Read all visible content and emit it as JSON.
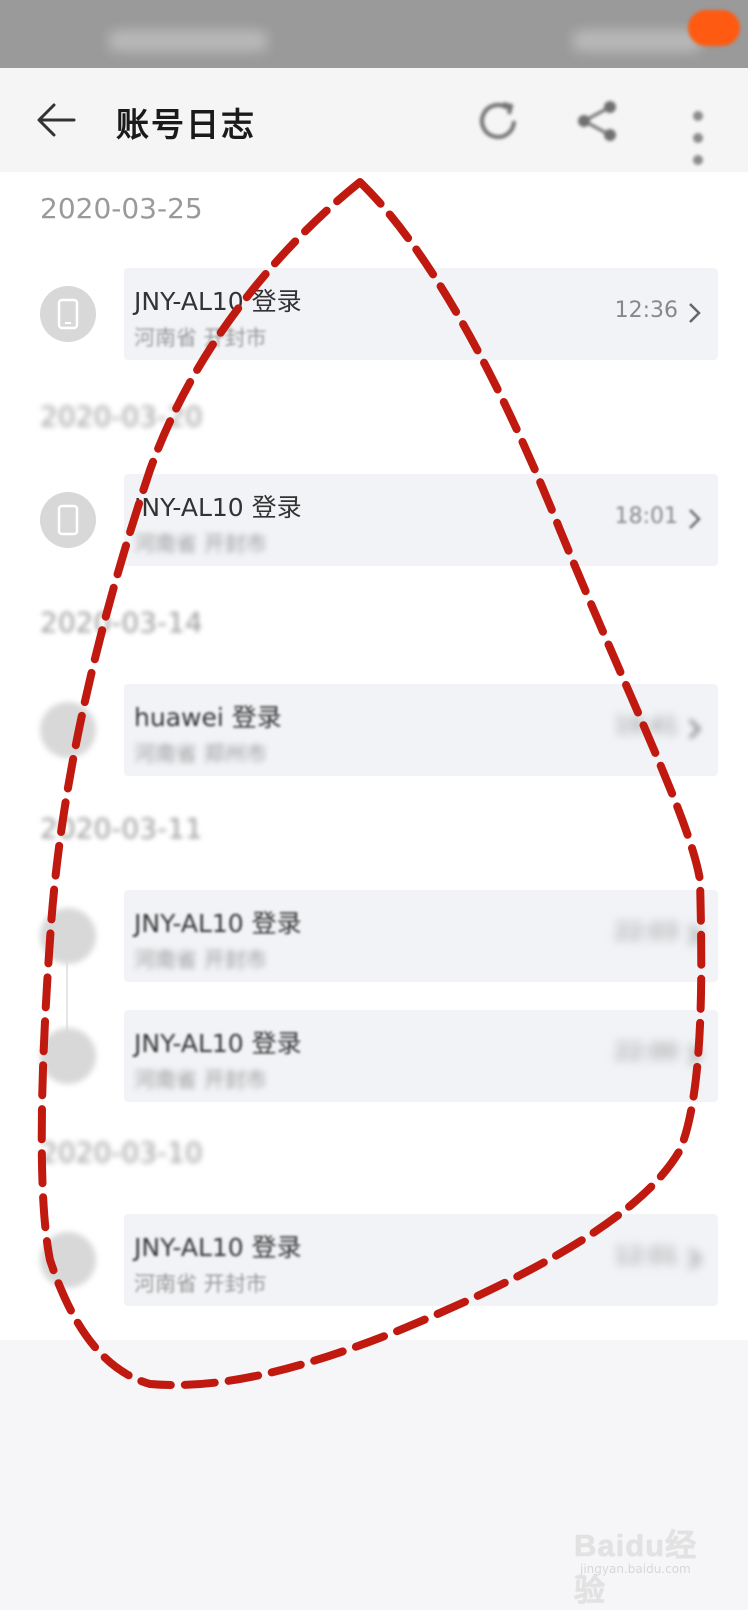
{
  "app_bar": {
    "title": "账号日志",
    "icons": {
      "back": "back-arrow-icon",
      "refresh": "refresh-icon",
      "share": "share-icon",
      "more": "more-vertical-icon"
    }
  },
  "log_groups": [
    {
      "date": "2020-03-25",
      "entries": [
        {
          "device": "JNY-AL10 登录",
          "location": "河南省 开封市",
          "time": "12:36"
        }
      ]
    },
    {
      "date": "2020-03-20",
      "entries": [
        {
          "device": "JNY-AL10 登录",
          "location": "河南省 开封市",
          "time": "18:01"
        }
      ]
    },
    {
      "date": "2020-03-14",
      "entries": [
        {
          "device": "huawei 登录",
          "location": "河南省 郑州市",
          "time": "19:41"
        }
      ]
    },
    {
      "date": "2020-03-11",
      "entries": [
        {
          "device": "JNY-AL10 登录",
          "location": "河南省 开封市",
          "time": "22:03"
        },
        {
          "device": "JNY-AL10 登录",
          "location": "河南省 开封市",
          "time": "22:00"
        }
      ]
    },
    {
      "date": "2020-03-10",
      "entries": [
        {
          "device": "JNY-AL10 登录",
          "location": "河南省 开封市",
          "time": "12:01"
        }
      ]
    }
  ],
  "watermark": {
    "brand": "Baidu经验",
    "url": "jingyan.baidu.com"
  },
  "colors": {
    "annotation_stroke": "#c0190f",
    "badge": "#ff5a12"
  }
}
